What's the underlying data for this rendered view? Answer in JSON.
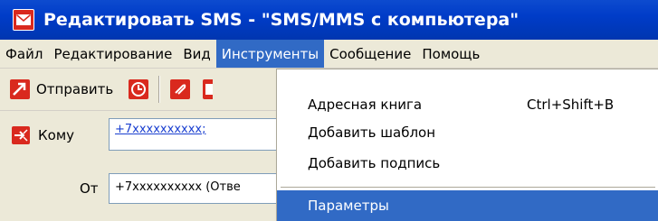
{
  "window": {
    "title": "Редактировать SMS - \"SMS/MMS с компьютера\""
  },
  "menubar": {
    "items": [
      {
        "label": "Файл"
      },
      {
        "label": "Редактирование"
      },
      {
        "label": "Вид"
      },
      {
        "label": "Инструменты",
        "active": true
      },
      {
        "label": "Сообщение"
      },
      {
        "label": "Помощь"
      }
    ]
  },
  "toolbar": {
    "send_label": "Отправить"
  },
  "compose": {
    "to_label": "Кому",
    "to_value": "+7xxxxxxxxxx;",
    "from_label": "От",
    "from_value": "+7xxxxxxxxxx (Отве"
  },
  "tools_menu": {
    "address_book": {
      "label": "Адресная книга",
      "shortcut": "Ctrl+Shift+B"
    },
    "add_template": {
      "label": "Добавить шаблон"
    },
    "add_signature": {
      "label": "Добавить подпись"
    },
    "settings": {
      "label": "Параметры"
    }
  },
  "colors": {
    "title_bar": "#0040c8",
    "highlight": "#316ac5",
    "menu_bg": "#ece9d8",
    "brand_red": "#d9291e"
  }
}
